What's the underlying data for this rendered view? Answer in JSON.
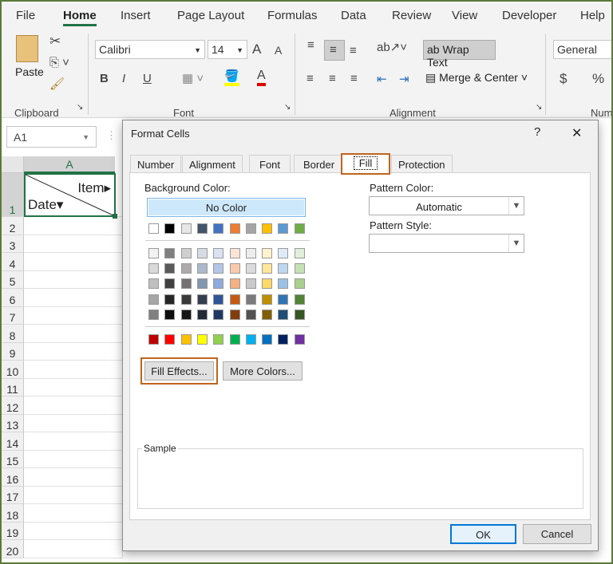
{
  "ribbon_tabs": [
    "File",
    "Home",
    "Insert",
    "Page Layout",
    "Formulas",
    "Data",
    "Review",
    "View",
    "Developer",
    "Help"
  ],
  "active_tab": "Home",
  "clipboard": {
    "paste": "Paste",
    "group": "Clipboard"
  },
  "font": {
    "name": "Calibri",
    "size": "14",
    "bold": "B",
    "italic": "I",
    "underline": "U",
    "grow": "A",
    "shrink": "A",
    "color_letter": "A",
    "group": "Font"
  },
  "alignment": {
    "wrap_text": "Wrap Text",
    "merge_center": "Merge & Center",
    "group": "Alignment"
  },
  "number": {
    "format": "General",
    "currency": "$",
    "percent": "%",
    "group": "Num"
  },
  "namebox": "A1",
  "sheet": {
    "column": "A",
    "rows": [
      "1",
      "2",
      "3",
      "4",
      "5",
      "6",
      "7",
      "8",
      "9",
      "10",
      "11",
      "12",
      "13",
      "14",
      "15",
      "16",
      "17",
      "18",
      "19",
      "20"
    ],
    "a1_top": "Item",
    "a1_bottom": "Date"
  },
  "dialog": {
    "title": "Format Cells",
    "help": "?",
    "close": "✕",
    "tabs": [
      "Number",
      "Alignment",
      "Font",
      "Border",
      "Fill",
      "Protection"
    ],
    "active_tab": "Fill",
    "background_color_label": "Background Color:",
    "no_color": "No Color",
    "theme_colors": [
      [
        "#FFFFFF",
        "#000000",
        "#E7E6E6",
        "#44546A",
        "#4472C4",
        "#ED7D31",
        "#A5A5A5",
        "#FFC000",
        "#5B9BD5",
        "#70AD47"
      ],
      [
        "#F2F2F2",
        "#7F7F7F",
        "#D0CECE",
        "#D6DCE4",
        "#D9E1F2",
        "#FCE4D6",
        "#EDEDED",
        "#FFF2CC",
        "#DDEBF7",
        "#E2EFDA"
      ],
      [
        "#D9D9D9",
        "#595959",
        "#AEAAAA",
        "#ACB9CA",
        "#B4C6E7",
        "#F8CBAD",
        "#DBDBDB",
        "#FFE699",
        "#BDD7EE",
        "#C6E0B4"
      ],
      [
        "#BFBFBF",
        "#404040",
        "#757171",
        "#8497B0",
        "#8EA9DB",
        "#F4B084",
        "#C9C9C9",
        "#FFD966",
        "#9BC2E6",
        "#A9D08E"
      ],
      [
        "#A6A6A6",
        "#262626",
        "#3A3838",
        "#333F4F",
        "#2F5597",
        "#C65911",
        "#7B7B7B",
        "#BF8F00",
        "#2F75B5",
        "#548235"
      ],
      [
        "#808080",
        "#0D0D0D",
        "#161616",
        "#222B35",
        "#203764",
        "#833C0C",
        "#525252",
        "#806000",
        "#1F4E78",
        "#375623"
      ]
    ],
    "standard_colors": [
      "#C00000",
      "#FF0000",
      "#FFC000",
      "#FFFF00",
      "#92D050",
      "#00B050",
      "#00B0F0",
      "#0070C0",
      "#002060",
      "#7030A0"
    ],
    "fill_effects": "Fill Effects...",
    "more_colors": "More Colors...",
    "pattern_color_label": "Pattern Color:",
    "pattern_color_value": "Automatic",
    "pattern_style_label": "Pattern Style:",
    "pattern_style_value": "",
    "sample_label": "Sample",
    "ok": "OK",
    "cancel": "Cancel"
  },
  "highlight_color": "#C0651E"
}
